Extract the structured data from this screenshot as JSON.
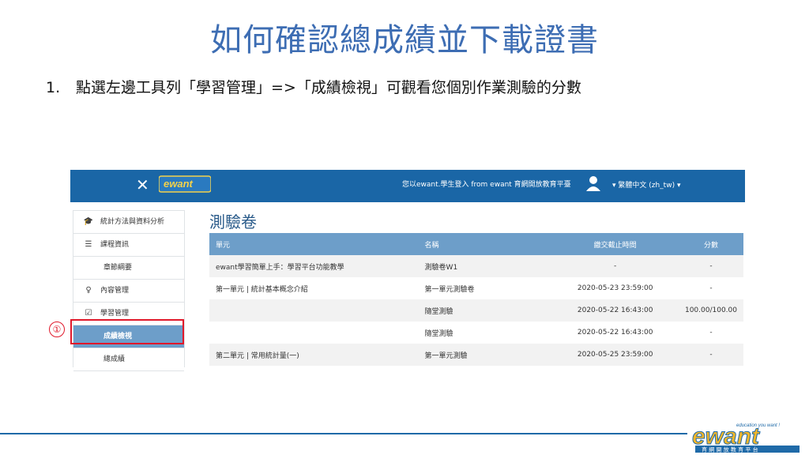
{
  "slide": {
    "title": "如何確認總成績並下載證書",
    "step_number": "1.",
    "step_text": "點選左邊工具列「學習管理」=>「成績檢視」可觀看您個別作業測驗的分數",
    "marker": "①"
  },
  "nav": {
    "close_glyph": "✕",
    "login_text": "您以ewant.學生登入  from ewant 育網開放教育平臺",
    "language": "▾ 繁體中文 (zh_tw) ▾"
  },
  "sidebar": {
    "items": [
      {
        "icon": "🎓",
        "label": "統計方法與資料分析"
      },
      {
        "icon": "☰",
        "label": "課程資訊"
      },
      {
        "icon": "",
        "label": "章節綱要"
      },
      {
        "icon": "♀",
        "label": "內容管理"
      },
      {
        "icon": "☑",
        "label": "學習管理"
      },
      {
        "icon": "",
        "label": "成績檢視"
      },
      {
        "icon": "",
        "label": "總成績"
      }
    ]
  },
  "main": {
    "title": "測驗卷",
    "headers": [
      "單元",
      "名稱",
      "繳交截止時間",
      "分數"
    ],
    "rows": [
      [
        "ewant學習簡單上手：學習平台功能教學",
        "測驗卷W1",
        "-",
        "-"
      ],
      [
        "第一單元 | 統計基本概念介紹",
        "第一單元測驗卷",
        "2020-05-23 23:59:00",
        "-"
      ],
      [
        "",
        "隨堂測驗",
        "2020-05-22 16:43:00",
        "100.00/100.00"
      ],
      [
        "",
        "隨堂測驗",
        "2020-05-22 16:43:00",
        "-"
      ],
      [
        "第二單元 | 常用統計量(一)",
        "第一單元測驗",
        "2020-05-25 23:59:00",
        "-"
      ]
    ]
  },
  "footer": {
    "logo_text": "ewant",
    "tagline": "education you want !",
    "chinese": "育 網 開 放 教 育 平 台"
  },
  "colors": {
    "title": "#3d6db3",
    "nav": "#1a66a6",
    "active": "#6d9ec9",
    "highlight": "#e0182a"
  }
}
